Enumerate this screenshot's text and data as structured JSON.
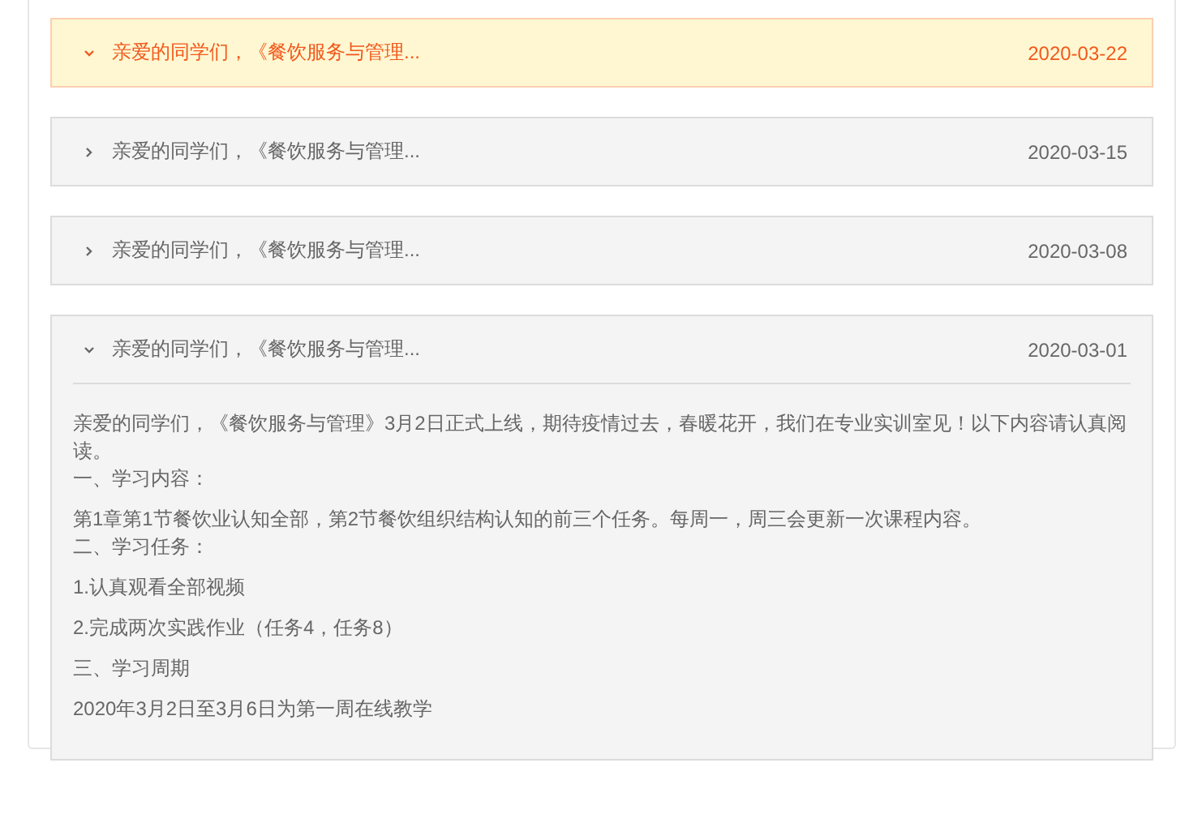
{
  "notices": [
    {
      "title": "亲爱的同学们，《餐饮服务与管理...",
      "date": "2020-03-22",
      "selected": true,
      "expanded": false
    },
    {
      "title": "亲爱的同学们，《餐饮服务与管理...",
      "date": "2020-03-15",
      "selected": false,
      "expanded": false
    },
    {
      "title": "亲爱的同学们，《餐饮服务与管理...",
      "date": "2020-03-08",
      "selected": false,
      "expanded": false
    },
    {
      "title": "亲爱的同学们，《餐饮服务与管理...",
      "date": "2020-03-01",
      "selected": false,
      "expanded": true,
      "body": [
        [
          "亲爱的同学们，《餐饮服务与管理》3月2日正式上线，期待疫情过去，春暖花开，我们在专业实训室见！以下内容请认真阅读。",
          "一、学习内容："
        ],
        [
          "第1章第1节餐饮业认知全部，第2节餐饮组织结构认知的前三个任务。每周一，周三会更新一次课程内容。",
          "二、学习任务："
        ],
        [
          "1.认真观看全部视频"
        ],
        [
          "2.完成两次实践作业（任务4，任务8）"
        ],
        [
          "三、学习周期"
        ],
        [
          "2020年3月2日至3月6日为第一周在线教学"
        ]
      ]
    }
  ]
}
